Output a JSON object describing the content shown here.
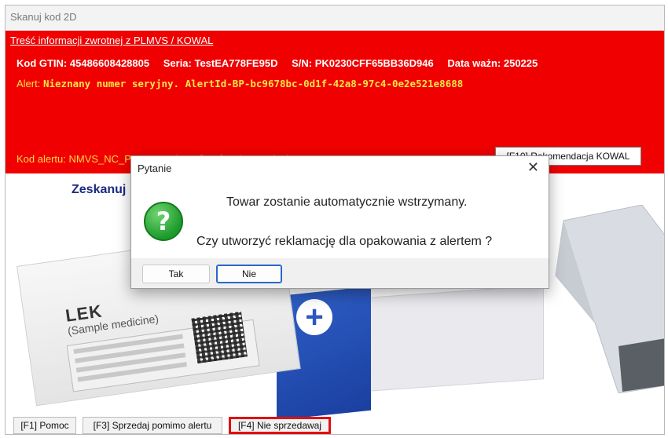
{
  "window": {
    "title": "Skanuj kod 2D"
  },
  "alert_panel": {
    "header": "Treść informacji zwrotnej z PLMVS / KOWAL",
    "info": {
      "gtin": "Kod GTIN: 45486608428805",
      "serial": "Seria: TestEA778FE95D",
      "sn": "S/N: PK0230CFF65BB36D946",
      "expiry": "Data ważn: 250225"
    },
    "alert_label": "Alert:",
    "alert_text": "Nieznany numer seryjny. AlertId-BP-bc9678bc-0d1f-42a8-97c4-0e2e521e8688",
    "alert_code": "Kod alertu: NMVS_NC_PC_02 - zobacz [F10] Rekomendacje KOWAL",
    "recommend_button": "[F10] Rekomendacja KOWAL"
  },
  "scan_heading": "Zeskanuj",
  "illustration": {
    "product_name": "LEK",
    "product_sub": "(Sample medicine)"
  },
  "dialog": {
    "title": "Pytanie",
    "message_1": "Towar zostanie automatycznie wstrzymany.",
    "message_2": "Czy utworzyć reklamację dla opakowania z alertem ?",
    "yes_label": "Tak",
    "no_label": "Nie",
    "icon": "question-icon"
  },
  "footer": {
    "help": "[F1] Pomoc",
    "sell_anyway": "[F3] Sprzedaj pomimo alertu",
    "dont_sell": "[F4] Nie sprzedawaj"
  },
  "colors": {
    "alert_background": "#f00000",
    "alert_yellow": "#ffe34a",
    "heading_blue": "#1a2a80",
    "highlight_red": "#e01010",
    "focus_blue": "#2a69c6"
  }
}
